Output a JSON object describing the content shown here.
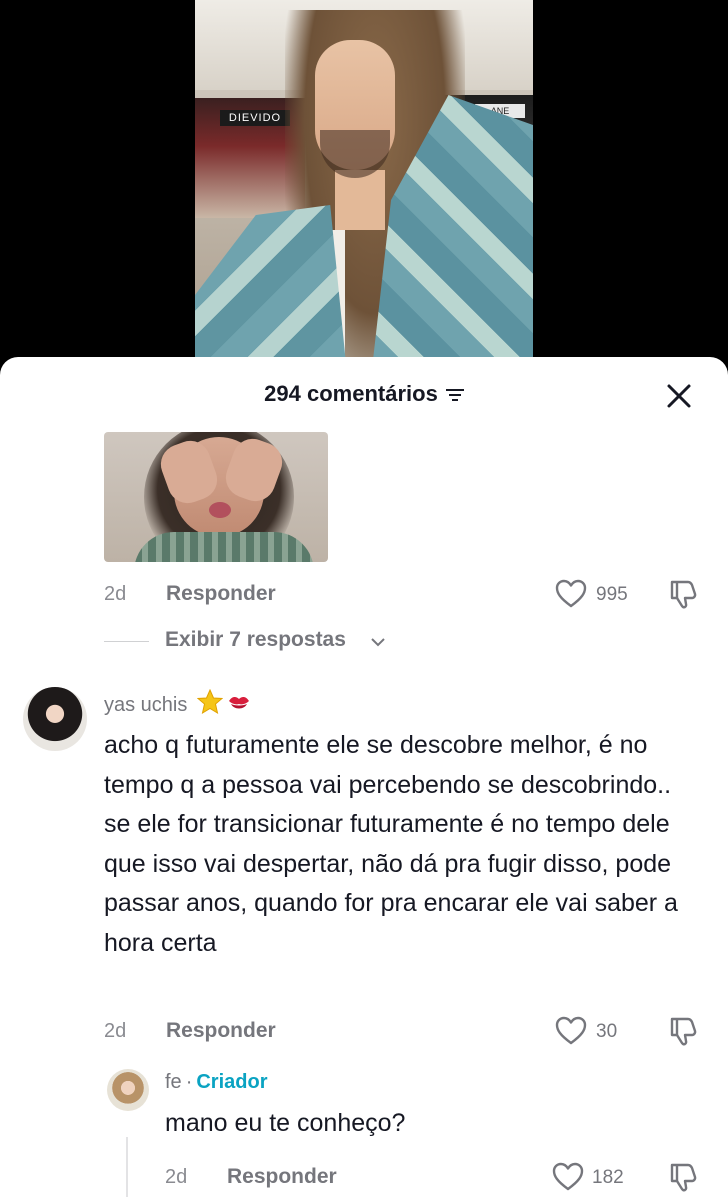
{
  "video": {
    "sign_left": "DIEVIDO",
    "sign_right": "ANE"
  },
  "header": {
    "title": "294 comentários",
    "sort_icon": "sort-lines-icon",
    "close_icon": "close-icon"
  },
  "comment1": {
    "time": "2d",
    "reply_label": "Responder",
    "like_count": "995",
    "view_replies": "Exibir 7 respostas"
  },
  "comment2": {
    "username": "yas uchis",
    "emojis": [
      "star",
      "kiss-mark"
    ],
    "text": "acho q futuramente ele se descobre melhor, é no tempo q a pessoa vai percebendo se descobrindo.. se ele for transicionar futuramente é no tempo dele que isso vai despertar, não dá pra fugir disso, pode passar anos, quando for pra encarar ele vai saber a hora certa",
    "time": "2d",
    "reply_label": "Responder",
    "like_count": "30"
  },
  "reply1": {
    "username": "fe",
    "separator": "·",
    "badge": "Criador",
    "text": "mano eu te conheço?",
    "time": "2d",
    "reply_label": "Responder",
    "like_count": "182"
  },
  "colors": {
    "creator": "#0aa3c2",
    "muted": "#75767c",
    "text": "#161823"
  }
}
